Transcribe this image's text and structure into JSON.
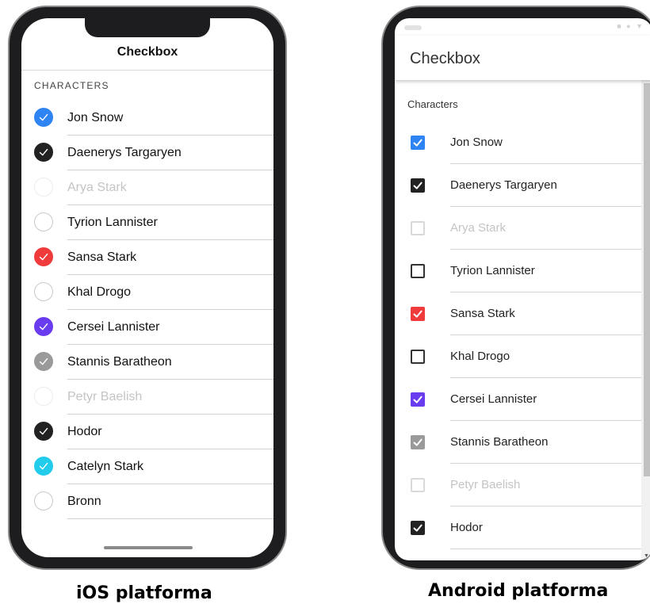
{
  "colors": {
    "ios_blue": "#2f84f3",
    "ios_black": "#222222",
    "ios_red": "#ef3b3b",
    "ios_purple": "#6a3cf0",
    "ios_gray": "#9a9a9a",
    "ios_cyan": "#22ccea",
    "android_blue": "#2f84f3",
    "android_black": "#222222",
    "android_red": "#ef3b3b",
    "android_purple": "#6a3cf0",
    "android_gray": "#9a9a9a"
  },
  "ios": {
    "title": "Checkbox",
    "section_header": "CHARACTERS",
    "caption": "iOS platforma",
    "items": [
      {
        "label": "Jon Snow",
        "checked": true,
        "color": "#2f84f3",
        "disabled": false
      },
      {
        "label": "Daenerys Targaryen",
        "checked": true,
        "color": "#222222",
        "disabled": false
      },
      {
        "label": "Arya Stark",
        "checked": false,
        "color": "",
        "disabled": true
      },
      {
        "label": "Tyrion Lannister",
        "checked": false,
        "color": "",
        "disabled": false
      },
      {
        "label": "Sansa Stark",
        "checked": true,
        "color": "#ef3b3b",
        "disabled": false
      },
      {
        "label": "Khal Drogo",
        "checked": false,
        "color": "",
        "disabled": false
      },
      {
        "label": "Cersei Lannister",
        "checked": true,
        "color": "#6a3cf0",
        "disabled": false
      },
      {
        "label": "Stannis Baratheon",
        "checked": true,
        "color": "#9a9a9a",
        "disabled": false
      },
      {
        "label": "Petyr Baelish",
        "checked": false,
        "color": "",
        "disabled": true
      },
      {
        "label": "Hodor",
        "checked": true,
        "color": "#222222",
        "disabled": false
      },
      {
        "label": "Catelyn Stark",
        "checked": true,
        "color": "#22ccea",
        "disabled": false
      },
      {
        "label": "Bronn",
        "checked": false,
        "color": "",
        "disabled": false
      }
    ]
  },
  "android": {
    "title": "Checkbox",
    "section_header": "Characters",
    "caption": "Android platforma",
    "items": [
      {
        "label": "Jon Snow",
        "checked": true,
        "color": "#2f84f3",
        "disabled": false
      },
      {
        "label": "Daenerys Targaryen",
        "checked": true,
        "color": "#222222",
        "disabled": false
      },
      {
        "label": "Arya Stark",
        "checked": false,
        "color": "",
        "disabled": true
      },
      {
        "label": "Tyrion Lannister",
        "checked": false,
        "color": "",
        "disabled": false
      },
      {
        "label": "Sansa Stark",
        "checked": true,
        "color": "#ef3b3b",
        "disabled": false
      },
      {
        "label": "Khal Drogo",
        "checked": false,
        "color": "",
        "disabled": false
      },
      {
        "label": "Cersei Lannister",
        "checked": true,
        "color": "#6a3cf0",
        "disabled": false
      },
      {
        "label": "Stannis Baratheon",
        "checked": true,
        "color": "#9a9a9a",
        "disabled": false
      },
      {
        "label": "Petyr Baelish",
        "checked": false,
        "color": "",
        "disabled": true
      },
      {
        "label": "Hodor",
        "checked": true,
        "color": "#222222",
        "disabled": false
      }
    ]
  }
}
